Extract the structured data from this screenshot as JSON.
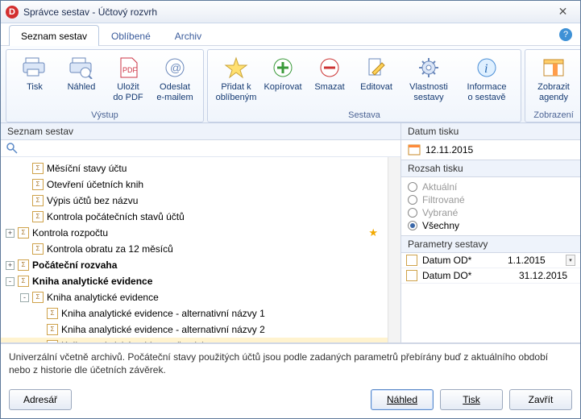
{
  "window": {
    "title": "Správce sestav - Účtový rozvrh"
  },
  "tabs": {
    "list": "Seznam sestav",
    "fav": "Oblíbené",
    "archive": "Archiv"
  },
  "ribbon": {
    "output_group": "Výstup",
    "report_group": "Sestava",
    "view_group": "Zobrazení",
    "print": "Tisk",
    "preview": "Náhled",
    "savepdf": "Uložit\ndo PDF",
    "email": "Odeslat\ne-mailem",
    "addfav": "Přidat k\noblíbeným",
    "copy": "Kopírovat",
    "delete": "Smazat",
    "edit": "Editovat",
    "props": "Vlastnosti\nsestavy",
    "info": "Informace\no sestavě",
    "showagenda": "Zobrazit\nagendy"
  },
  "left_header": "Seznam sestav",
  "search_placeholder": "",
  "tree": [
    {
      "indent": 1,
      "toggle": "",
      "label": "Měsíční stavy účtu"
    },
    {
      "indent": 1,
      "toggle": "",
      "label": "Otevření účetních knih"
    },
    {
      "indent": 1,
      "toggle": "",
      "label": "Výpis účtů bez názvu"
    },
    {
      "indent": 1,
      "toggle": "",
      "label": "Kontrola počátečních stavů účtů"
    },
    {
      "indent": 0,
      "toggle": "+",
      "label": "Kontrola rozpočtu",
      "star": true
    },
    {
      "indent": 1,
      "toggle": "",
      "label": "Kontrola obratu za 12 měsíců"
    },
    {
      "indent": 0,
      "toggle": "+",
      "label": "Počáteční rozvaha",
      "bold": true
    },
    {
      "indent": 0,
      "toggle": "-",
      "label": "Kniha analytické evidence",
      "bold": true
    },
    {
      "indent": 1,
      "toggle": "-",
      "label": "Kniha analytické evidence"
    },
    {
      "indent": 2,
      "toggle": "",
      "label": "Kniha analytické evidence - alternativní názvy 1"
    },
    {
      "indent": 2,
      "toggle": "",
      "label": "Kniha analytické evidence - alternativní názvy 2"
    },
    {
      "indent": 2,
      "toggle": "",
      "label": "Kniha analytické evidence (kopie)",
      "selected": true
    }
  ],
  "right": {
    "date_header": "Datum tisku",
    "date_value": "12.11.2015",
    "range_header": "Rozsah tisku",
    "radios": {
      "current": "Aktuální",
      "filtered": "Filtrované",
      "selected": "Vybrané",
      "all": "Všechny"
    },
    "params_header": "Parametry sestavy",
    "params": [
      {
        "label": "Datum OD*",
        "value": "1.1.2015",
        "dropdown": true
      },
      {
        "label": "Datum DO*",
        "value": "31.12.2015"
      }
    ]
  },
  "hint": "Univerzální včetně archivů. Počáteční stavy použitých účtů jsou podle zadaných parametrů přebírány buď z aktuálního období nebo z historie dle účetních závěrek.",
  "footer": {
    "dir": "Adresář",
    "preview": "Náhled",
    "print": "Tisk",
    "close": "Zavřít"
  }
}
